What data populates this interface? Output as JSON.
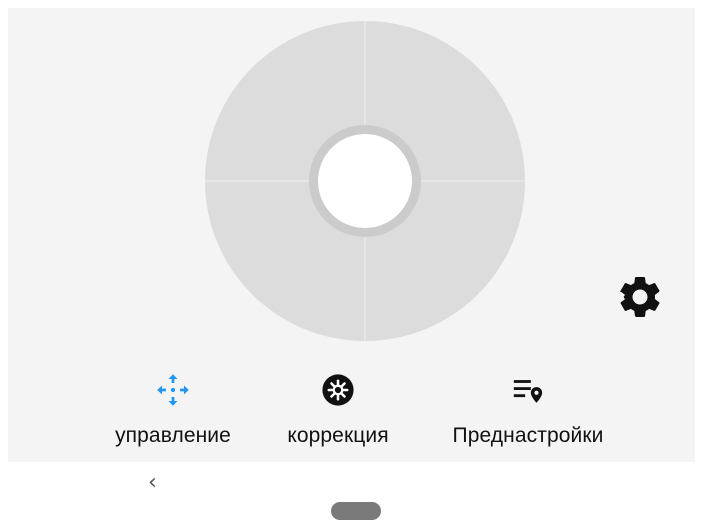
{
  "tabs": [
    {
      "label": "управление",
      "icon": "move-arrows-icon",
      "active": true,
      "color": "#2196f3"
    },
    {
      "label": "коррекция",
      "icon": "aperture-icon",
      "active": false,
      "color": "#111111"
    },
    {
      "label": "Преднастройки",
      "icon": "preset-list-location-icon",
      "active": false,
      "color": "#111111"
    }
  ],
  "settings": {
    "icon": "gear-icon"
  },
  "navigation": {
    "back_glyph": "‹",
    "home_icon": "home-pill-icon"
  },
  "colors": {
    "panel_bg": "#f4f4f4",
    "joystick_pad": "#dcdcdc",
    "joystick_ring": "#cbcbcb",
    "accent": "#2196f3"
  }
}
